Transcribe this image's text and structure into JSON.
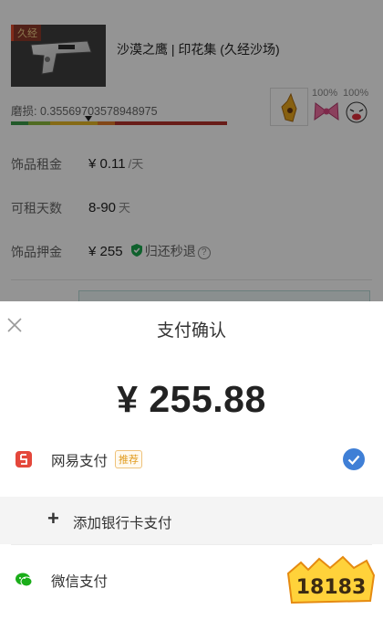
{
  "item": {
    "wear_tag": "久经",
    "name": "沙漠之鹰 | 印花集 (久经沙场)",
    "wear_label": "磨损: 0.35569703578948975",
    "wear_value": 0.35569703578948975,
    "sticker_wear_1": "100%",
    "sticker_wear_2": "100%"
  },
  "info": {
    "rent_label": "饰品租金",
    "rent_value": "¥ 0.11",
    "rent_unit": "/天",
    "days_label": "可租天数",
    "days_value": "8-90",
    "days_unit": "天",
    "deposit_label": "饰品押金",
    "deposit_value": "¥ 255",
    "deposit_note": "归还秒退",
    "help_icon": "?"
  },
  "sheet": {
    "title": "支付确认",
    "amount": "¥ 255.88",
    "options": [
      {
        "label": "网易支付",
        "badge": "推荐",
        "selected": true
      },
      {
        "label": "添加银行卡支付"
      },
      {
        "label": "微信支付"
      }
    ]
  },
  "icons": {
    "close": "close-icon",
    "check": "check-icon",
    "netease_pay": "netease-pay-icon",
    "wechat_pay": "wechat-pay-icon",
    "plus": "plus-icon",
    "shield": "shield-icon"
  },
  "colors": {
    "accent_blue": "#3f7fd6",
    "wechat_green": "#1aad19",
    "netease_red": "#e4473b",
    "badge_orange": "#e19b1e"
  },
  "watermark": {
    "text": "18183"
  }
}
